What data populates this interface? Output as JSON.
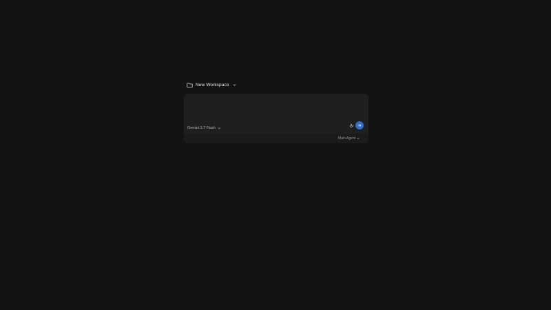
{
  "workspace": {
    "label": "New Workspace",
    "icon": "folder-icon"
  },
  "composer": {
    "placeholder": "",
    "value": "",
    "model_label": "Gemini 3.7 Flash",
    "agent_label": "Main Agent",
    "mic_icon": "microphone-icon",
    "send_icon": "arrow-right-icon"
  },
  "colors": {
    "background": "#131313",
    "composer": "#1f1f1f",
    "composer_footer": "#1b1b1b",
    "send_button": "#2e6fc9"
  }
}
